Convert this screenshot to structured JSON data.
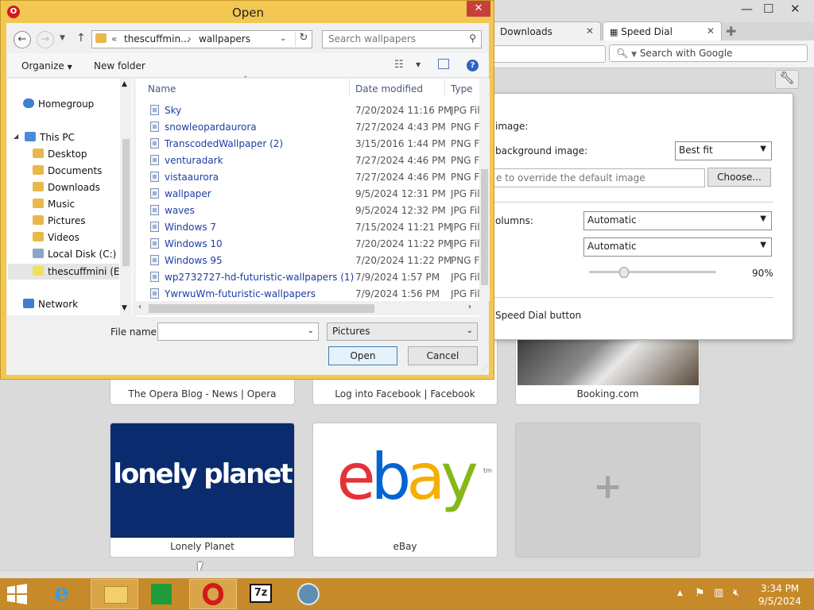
{
  "browser": {
    "tabs": [
      {
        "label": "Downloads"
      },
      {
        "label": "Speed Dial"
      }
    ],
    "search_placeholder": "Search with Google",
    "speed_dial": {
      "tiles": [
        {
          "label": "The Opera Blog - News | Opera"
        },
        {
          "label": "Log into Facebook | Facebook"
        },
        {
          "label": "Booking.com"
        },
        {
          "label": "Lonely Planet",
          "logo_text": "lonely planet"
        },
        {
          "label": "eBay",
          "logo_text": "ebay",
          "logo_tm": "tm"
        }
      ],
      "add_label": "+"
    },
    "settings": {
      "image_label": "image:",
      "bg_image_label": "background image:",
      "bg_image_value": "Best fit",
      "override_placeholder": "e to override the default image",
      "choose_label": "Choose...",
      "columns_label": "olumns:",
      "columns_value": "Automatic",
      "rows_value": "Automatic",
      "zoom_value": "90%",
      "zoom_fraction": 0.9,
      "speed_dial_button_label": "Speed Dial button"
    }
  },
  "dialog": {
    "title": "Open",
    "breadcrumb": {
      "root": "«",
      "parent": "thescuffmin...",
      "current": "wallpapers"
    },
    "search_placeholder": "Search wallpapers",
    "toolbar": {
      "organize_label": "Organize",
      "new_folder_label": "New folder"
    },
    "nav": [
      {
        "label": "Homegroup",
        "icon": "homegroup-icon"
      },
      {
        "label": "This PC",
        "icon": "computer-icon"
      },
      {
        "label": "Desktop",
        "icon": "folder-icon"
      },
      {
        "label": "Documents",
        "icon": "folder-icon"
      },
      {
        "label": "Downloads",
        "icon": "folder-icon"
      },
      {
        "label": "Music",
        "icon": "folder-icon"
      },
      {
        "label": "Pictures",
        "icon": "folder-icon"
      },
      {
        "label": "Videos",
        "icon": "folder-icon"
      },
      {
        "label": "Local Disk (C:)",
        "icon": "drive-icon"
      },
      {
        "label": "thescuffmini (E:)",
        "icon": "usb-drive-icon"
      },
      {
        "label": "Network",
        "icon": "network-icon"
      }
    ],
    "columns": {
      "name": "Name",
      "date": "Date modified",
      "type": "Type"
    },
    "files": [
      {
        "name": "Sky",
        "date": "7/20/2024 11:16 PM",
        "type": "JPG File"
      },
      {
        "name": "snowleopardaurora",
        "date": "7/27/2024 4:43 PM",
        "type": "PNG File"
      },
      {
        "name": "TranscodedWallpaper (2)",
        "date": "3/15/2016 1:44 PM",
        "type": "PNG File"
      },
      {
        "name": "venturadark",
        "date": "7/27/2024 4:46 PM",
        "type": "PNG File"
      },
      {
        "name": "vistaaurora",
        "date": "7/27/2024 4:46 PM",
        "type": "PNG File"
      },
      {
        "name": "wallpaper",
        "date": "9/5/2024 12:31 PM",
        "type": "JPG File"
      },
      {
        "name": "waves",
        "date": "9/5/2024 12:32 PM",
        "type": "JPG File"
      },
      {
        "name": "Windows 7",
        "date": "7/15/2024 11:21 PM",
        "type": "JPG File"
      },
      {
        "name": "Windows 10",
        "date": "7/20/2024 11:22 PM",
        "type": "JPG File"
      },
      {
        "name": "Windows 95",
        "date": "7/20/2024 11:22 PM",
        "type": "PNG File"
      },
      {
        "name": "wp2732727-hd-futuristic-wallpapers (1)",
        "date": "7/9/2024 1:57 PM",
        "type": "JPG File"
      },
      {
        "name": "YwrwuWm-futuristic-wallpapers",
        "date": "7/9/2024 1:56 PM",
        "type": "JPG File"
      }
    ],
    "filename_label": "File name:",
    "filename_value": "",
    "filter_value": "Pictures",
    "open_label": "Open",
    "cancel_label": "Cancel"
  },
  "taskbar": {
    "time": "3:34 PM",
    "date": "9/5/2024",
    "sevenzip_label": "7z"
  }
}
